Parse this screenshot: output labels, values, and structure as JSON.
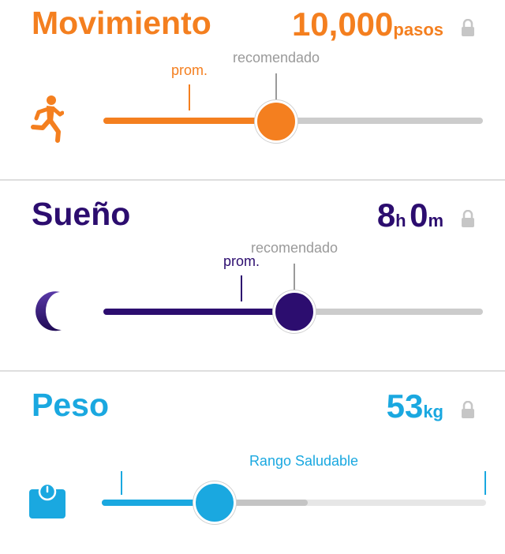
{
  "colors": {
    "movement": "#f47f1f",
    "sleep": "#2c0d6f",
    "weight": "#1aa8e0",
    "track": "#cccccc"
  },
  "movement": {
    "title": "Movimiento",
    "value": "10,000",
    "unit": "pasos",
    "avg_label": "prom.",
    "recommended_label": "recomendado",
    "icon": "running-person-icon",
    "locked": true
  },
  "sleep": {
    "title": "Sueño",
    "hours": "8",
    "hours_unit": "h",
    "minutes": "0",
    "minutes_unit": "m",
    "avg_label": "prom.",
    "recommended_label": "recomendado",
    "icon": "moon-icon",
    "locked": true
  },
  "weight": {
    "title": "Peso",
    "value": "53",
    "unit": "kg",
    "range_label": "Rango Saludable",
    "icon": "scale-icon",
    "locked": true
  }
}
